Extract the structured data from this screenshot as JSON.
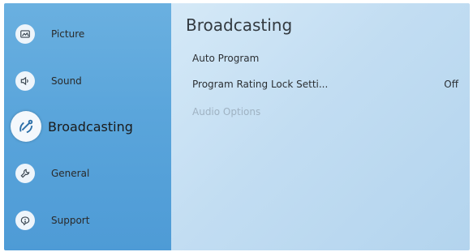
{
  "sidebar": {
    "items": [
      {
        "label": "Picture",
        "icon": "picture-icon"
      },
      {
        "label": "Sound",
        "icon": "sound-icon"
      },
      {
        "label": "Broadcasting",
        "icon": "broadcasting-icon",
        "selected": true
      },
      {
        "label": "General",
        "icon": "wrench-icon"
      },
      {
        "label": "Support",
        "icon": "support-icon"
      }
    ]
  },
  "main": {
    "title": "Broadcasting",
    "rows": [
      {
        "label": "Auto Program",
        "value": ""
      },
      {
        "label": "Program Rating Lock Setti...",
        "value": "Off"
      },
      {
        "label": "Audio Options",
        "value": "",
        "disabled": true
      }
    ]
  },
  "colors": {
    "sidebar": "#5aa5db",
    "content": "#c2ddf2",
    "disabled_text": "#9fb2c2"
  }
}
